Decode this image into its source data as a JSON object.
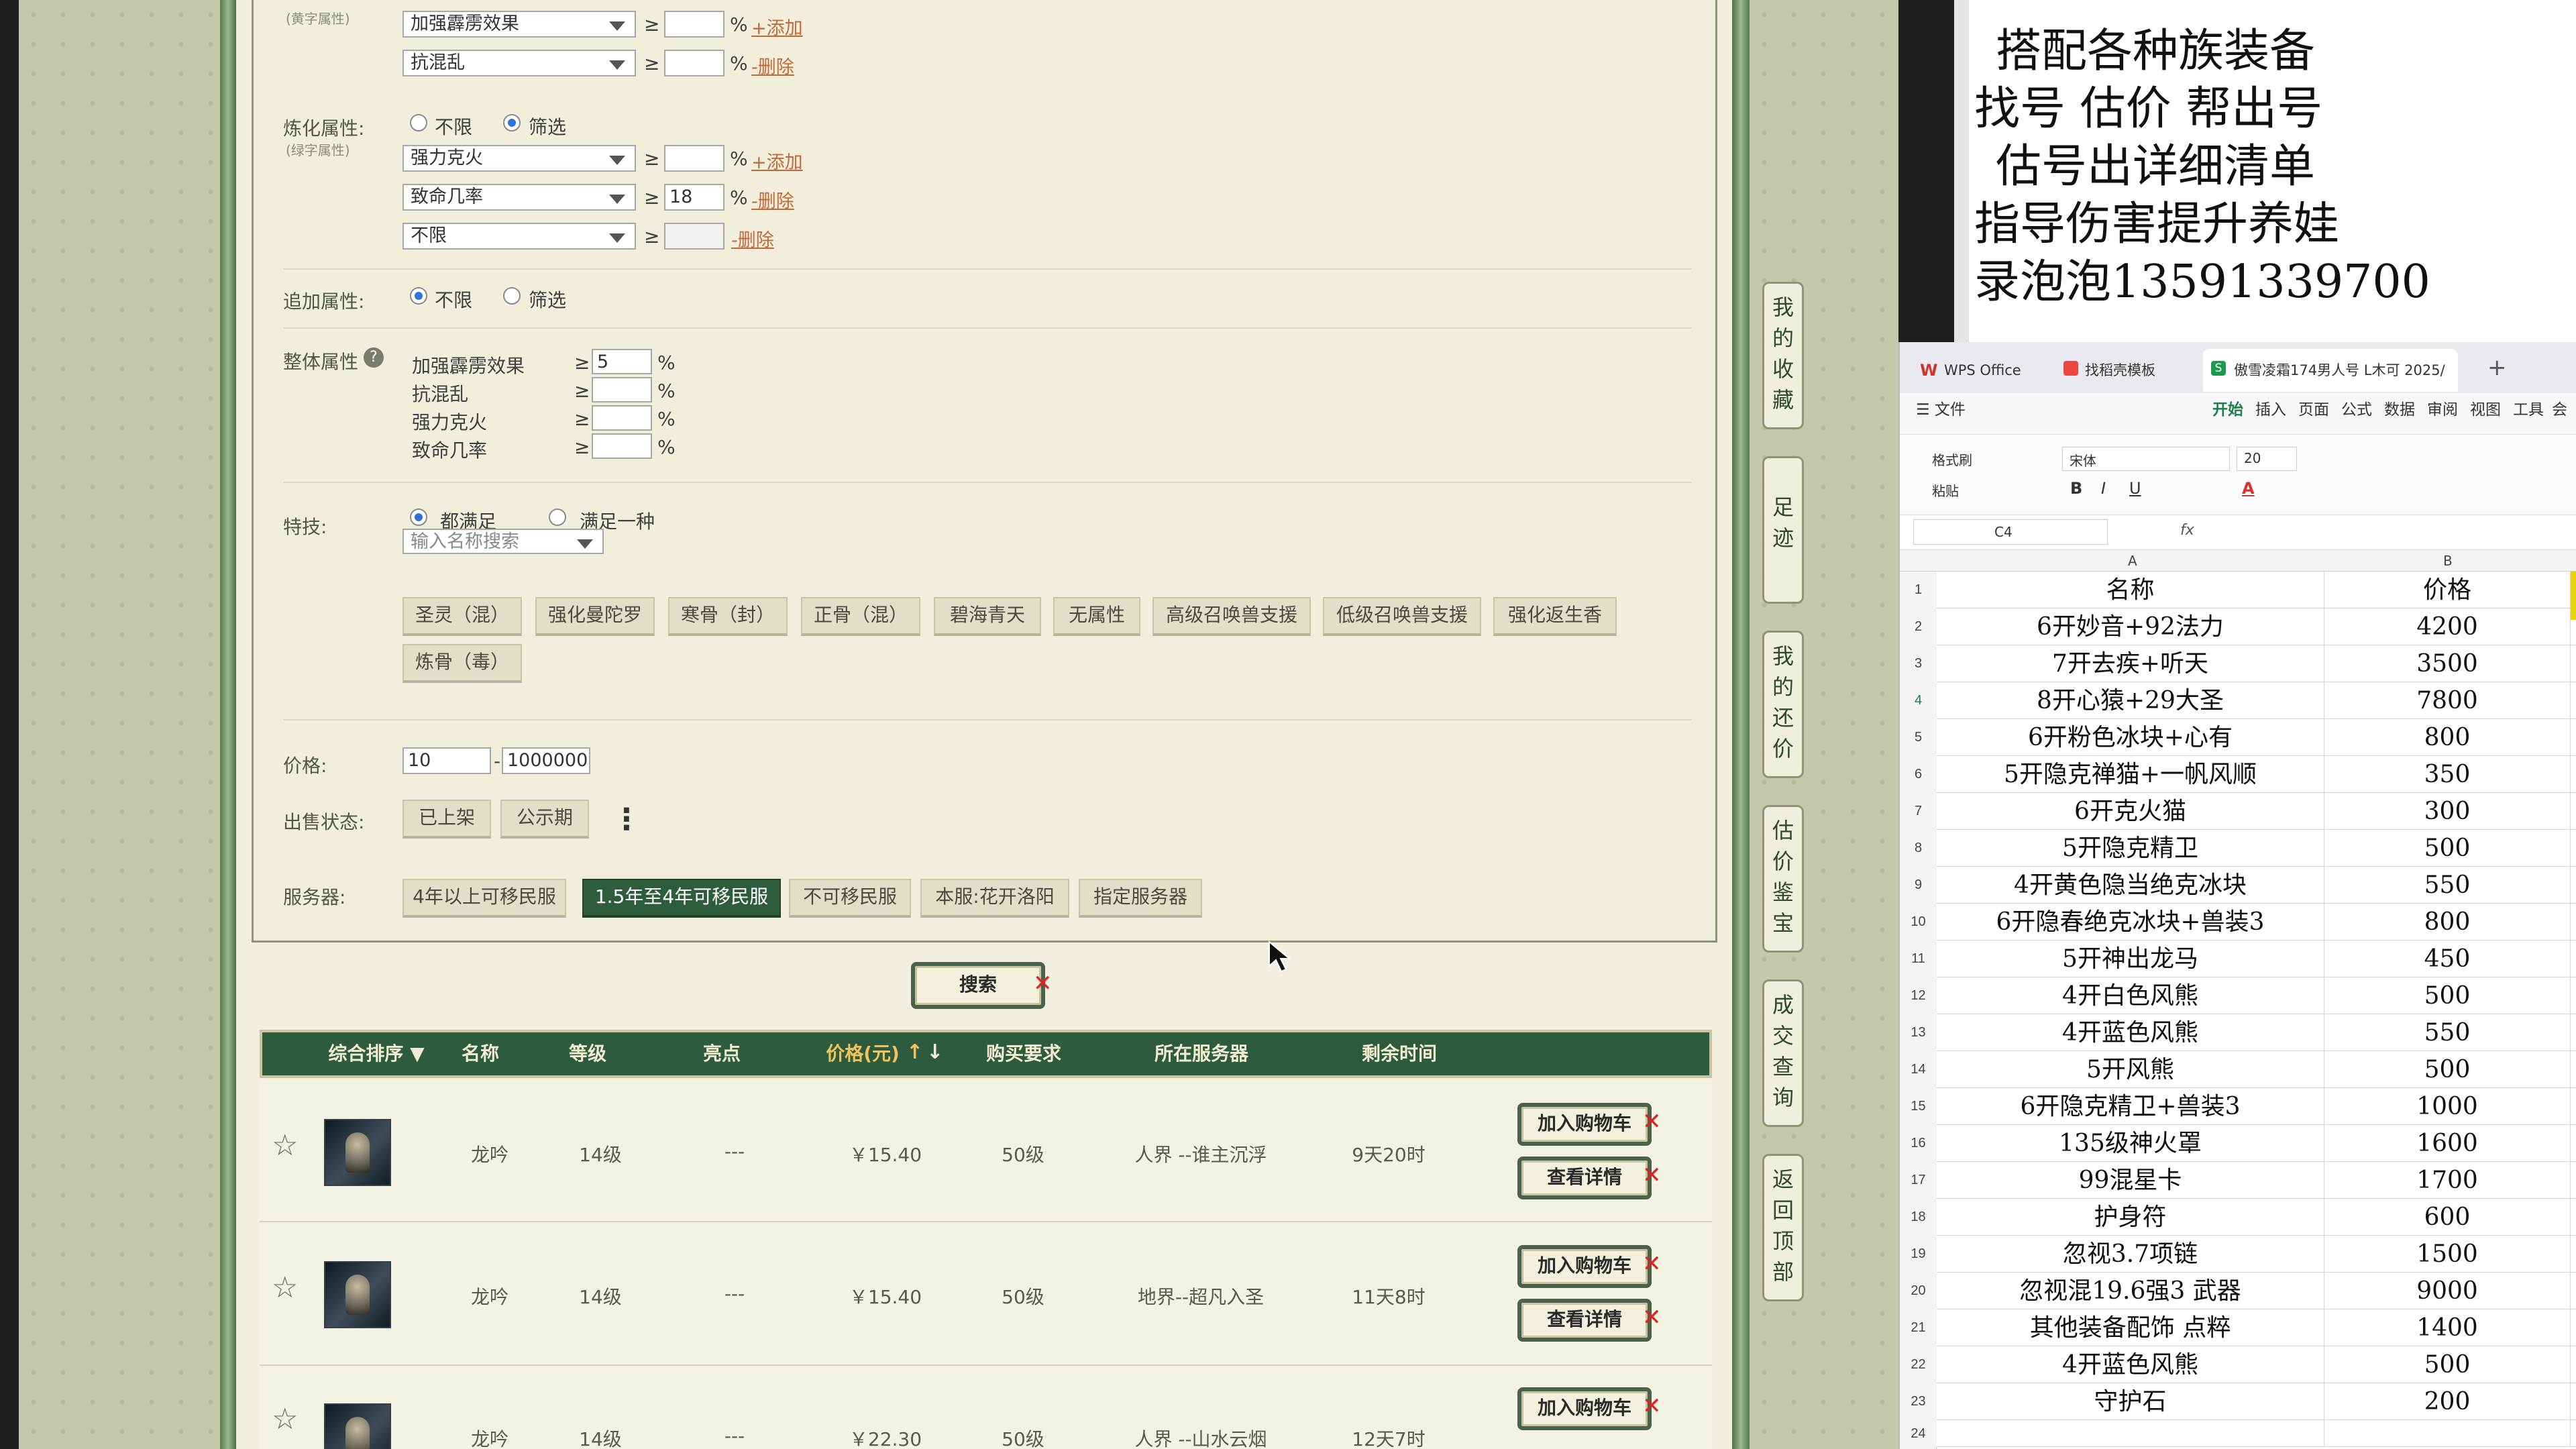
{
  "filters": {
    "top_rows": [
      {
        "select": "加强霹雳效果",
        "op": "≥",
        "unit": "%",
        "action": "+添加"
      },
      {
        "select": "抗混乱",
        "op": "≥",
        "unit": "%",
        "action": "-删除"
      }
    ],
    "yellow_note": "(黄字属性)",
    "lianhua": {
      "label": "炼化属性:",
      "note": "(绿字属性)",
      "opt_any": "不限",
      "opt_filter": "筛选",
      "rows": [
        {
          "select": "强力克火",
          "op": "≥",
          "value": "",
          "unit": "%",
          "action": "+添加"
        },
        {
          "select": "致命几率",
          "op": "≥",
          "value": "18",
          "unit": "%",
          "action": "-删除"
        },
        {
          "select": "不限",
          "op": "≥",
          "value": "",
          "unit": "",
          "action": "-删除"
        }
      ]
    },
    "zhuijia": {
      "label": "追加属性:",
      "opt_any": "不限",
      "opt_filter": "筛选"
    },
    "zhengti": {
      "label": "整体属性",
      "help": "?",
      "rows": [
        {
          "name": "加强霹雳效果",
          "op": "≥",
          "value": "5",
          "unit": "%"
        },
        {
          "name": "抗混乱",
          "op": "≥",
          "value": "",
          "unit": "%"
        },
        {
          "name": "强力克火",
          "op": "≥",
          "value": "",
          "unit": "%"
        },
        {
          "name": "致命几率",
          "op": "≥",
          "value": "",
          "unit": "%"
        }
      ]
    },
    "teji": {
      "label": "特技:",
      "opt_all": "都满足",
      "opt_one": "满足一种",
      "search_placeholder": "输入名称搜索",
      "tags": [
        "圣灵（混）",
        "强化曼陀罗",
        "寒骨（封）",
        "正骨（混）",
        "碧海青天",
        "无属性",
        "高级召唤兽支援",
        "低级召唤兽支援",
        "强化返生香",
        "炼骨（毒）"
      ]
    },
    "price": {
      "label": "价格:",
      "min": "10",
      "sep": "-",
      "max": "1000000"
    },
    "status": {
      "label": "出售状态:",
      "options": [
        "已上架",
        "公示期"
      ],
      "more": "⋮"
    },
    "server": {
      "label": "服务器:",
      "options": [
        "4年以上可移民服",
        "1.5年至4年可移民服",
        "不可移民服",
        "本服:花开洛阳",
        "指定服务器"
      ],
      "selected": 1
    },
    "search_button": "搜索"
  },
  "sidebar": [
    "我的收藏",
    "足迹",
    "我的还价",
    "估价鉴宝",
    "成交查询",
    "返回顶部"
  ],
  "table": {
    "headers": [
      "综合排序 ▼",
      "名称",
      "等级",
      "亮点",
      "价格(元)",
      "购买要求",
      "所在服务器",
      "剩余时间"
    ],
    "cart_button": "加入购物车",
    "detail_button": "查看详情",
    "rows": [
      {
        "name": "龙吟",
        "level": "14级",
        "highlight": "---",
        "price": "￥15.40",
        "req": "50级",
        "server": "人界 --谁主沉浮",
        "time": "9天20时"
      },
      {
        "name": "龙吟",
        "level": "14级",
        "highlight": "---",
        "price": "￥15.40",
        "req": "50级",
        "server": "地界--超凡入圣",
        "time": "11天8时"
      },
      {
        "name": "龙吟",
        "level": "14级",
        "highlight": "---",
        "price": "￥22.30",
        "req": "50级",
        "server": "人界 --山水云烟",
        "time": "12天7时"
      }
    ]
  },
  "promo": {
    "lines": [
      "搭配各种族装备",
      "找号  估价  帮出号",
      "估号出详细清单",
      "指导伤害提升养娃",
      "录泡泡13591339700"
    ]
  },
  "wps": {
    "tabs": [
      "WPS Office",
      "找稻壳模板",
      "傲雪凌霜174男人号 L木可 2025/"
    ],
    "menu": [
      "☰ 文件",
      "开始",
      "插入",
      "页面",
      "公式",
      "数据",
      "审阅",
      "视图",
      "工具",
      "会员"
    ],
    "font_name": "宋体",
    "font_size": "20",
    "ribbon_labels": [
      "格式刷",
      "粘贴"
    ],
    "cell_ref": "C4",
    "fx": "fx",
    "col_a": "A",
    "col_b": "B",
    "rows": [
      [
        "名称",
        "价格"
      ],
      [
        "6开妙音+92法力",
        "4200"
      ],
      [
        "7开去疾+听天",
        "3500"
      ],
      [
        "8开心猿+29大圣",
        "7800"
      ],
      [
        "6开粉色冰块+心有",
        "800"
      ],
      [
        "5开隐克禅猫+一帆风顺",
        "350"
      ],
      [
        "6开克火猫",
        "300"
      ],
      [
        "5开隐克精卫",
        "500"
      ],
      [
        "4开黄色隐当绝克冰块",
        "550"
      ],
      [
        "6开隐春绝克冰块+兽装3",
        "800"
      ],
      [
        "5开神出龙马",
        "450"
      ],
      [
        "4开白色风熊",
        "500"
      ],
      [
        "4开蓝色风熊",
        "550"
      ],
      [
        "5开风熊",
        "500"
      ],
      [
        "6开隐克精卫+兽装3",
        "1000"
      ],
      [
        "135级神火罩",
        "1600"
      ],
      [
        "99混星卡",
        "1700"
      ],
      [
        "护身符",
        "600"
      ],
      [
        "忽视3.7项链",
        "1500"
      ],
      [
        "忽视混19.6强3 武器",
        "9000"
      ],
      [
        "其他装备配饰  点粹",
        "1400"
      ],
      [
        "4开蓝色风熊",
        "500"
      ],
      [
        "守护石",
        "200"
      ],
      [
        "",
        ""
      ]
    ],
    "row_numbers": [
      "1",
      "2",
      "3",
      "4",
      "5",
      "6",
      "7",
      "8",
      "9",
      "10",
      "11",
      "12",
      "13",
      "14",
      "15",
      "16",
      "17",
      "18",
      "19",
      "20",
      "21",
      "22",
      "23",
      "24"
    ]
  }
}
